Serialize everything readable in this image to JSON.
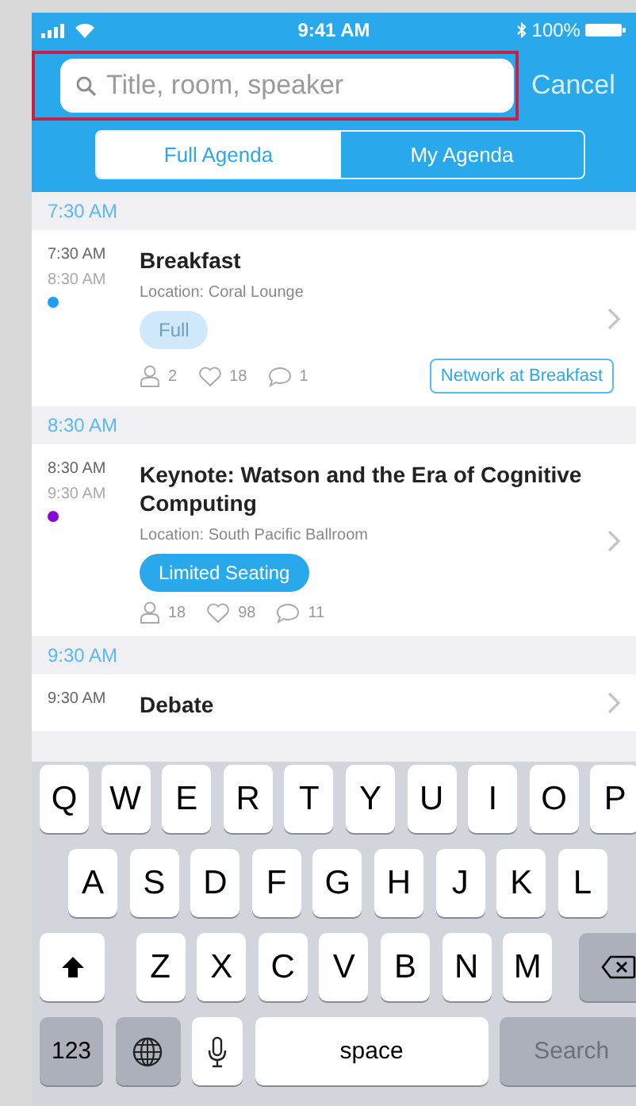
{
  "status_bar": {
    "time": "9:41 AM",
    "battery": "100%"
  },
  "search": {
    "placeholder": "Title, room, speaker",
    "highlighted": true
  },
  "cancel": "Cancel",
  "tabs": [
    {
      "label": "Full Agenda",
      "selected": true
    },
    {
      "label": "My Agenda",
      "selected": false
    }
  ],
  "sections": [
    {
      "time": "7:30 AM",
      "sessions": [
        {
          "start": "7:30 AM",
          "end": "8:30 AM",
          "color": "#1e9ef0",
          "title": "Breakfast",
          "location": "Location: Coral Lounge",
          "badge": {
            "label": "Full",
            "disabled": true
          },
          "attendees": "2",
          "likes": "18",
          "comments": "1",
          "tag": "Network at Breakfast"
        }
      ]
    },
    {
      "time": "8:30 AM",
      "sessions": [
        {
          "start": "8:30 AM",
          "end": "9:30 AM",
          "color": "#8a08d6",
          "title": "Keynote: Watson and the Era of Cognitive Computing",
          "location": "Location: South Pacific Ballroom",
          "badge": {
            "label": "Limited Seating",
            "disabled": false
          },
          "attendees": "18",
          "likes": "98",
          "comments": "11"
        }
      ]
    },
    {
      "time": "9:30 AM",
      "sessions": [
        {
          "start": "9:30 AM",
          "title": "Debate"
        }
      ]
    }
  ],
  "keyboard": [
    [
      {
        "kind": "letter",
        "label": "Q"
      },
      {
        "kind": "letter",
        "label": "W"
      },
      {
        "kind": "letter",
        "label": "E"
      },
      {
        "kind": "letter",
        "label": "R"
      },
      {
        "kind": "letter",
        "label": "T"
      },
      {
        "kind": "letter",
        "label": "Y"
      },
      {
        "kind": "letter",
        "label": "U"
      },
      {
        "kind": "letter",
        "label": "I"
      },
      {
        "kind": "letter",
        "label": "O"
      },
      {
        "kind": "letter",
        "label": "P"
      }
    ],
    [
      {
        "kind": "letter",
        "label": "A"
      },
      {
        "kind": "letter",
        "label": "S"
      },
      {
        "kind": "letter",
        "label": "D"
      },
      {
        "kind": "letter",
        "label": "F"
      },
      {
        "kind": "letter",
        "label": "G"
      },
      {
        "kind": "letter",
        "label": "H"
      },
      {
        "kind": "letter",
        "label": "J"
      },
      {
        "kind": "letter",
        "label": "K"
      },
      {
        "kind": "letter",
        "label": "L"
      }
    ],
    [
      {
        "kind": "shift"
      },
      {
        "kind": "letter",
        "label": "Z"
      },
      {
        "kind": "letter",
        "label": "X"
      },
      {
        "kind": "letter",
        "label": "C"
      },
      {
        "kind": "letter",
        "label": "V"
      },
      {
        "kind": "letter",
        "label": "B"
      },
      {
        "kind": "letter",
        "label": "N"
      },
      {
        "kind": "letter",
        "label": "M"
      },
      {
        "kind": "delete"
      }
    ],
    [
      {
        "kind": "mode",
        "label": "123"
      },
      {
        "kind": "globe"
      },
      {
        "kind": "mic"
      },
      {
        "kind": "space",
        "label": "space"
      },
      {
        "kind": "search",
        "label": "Search",
        "disabled": true
      }
    ]
  ]
}
